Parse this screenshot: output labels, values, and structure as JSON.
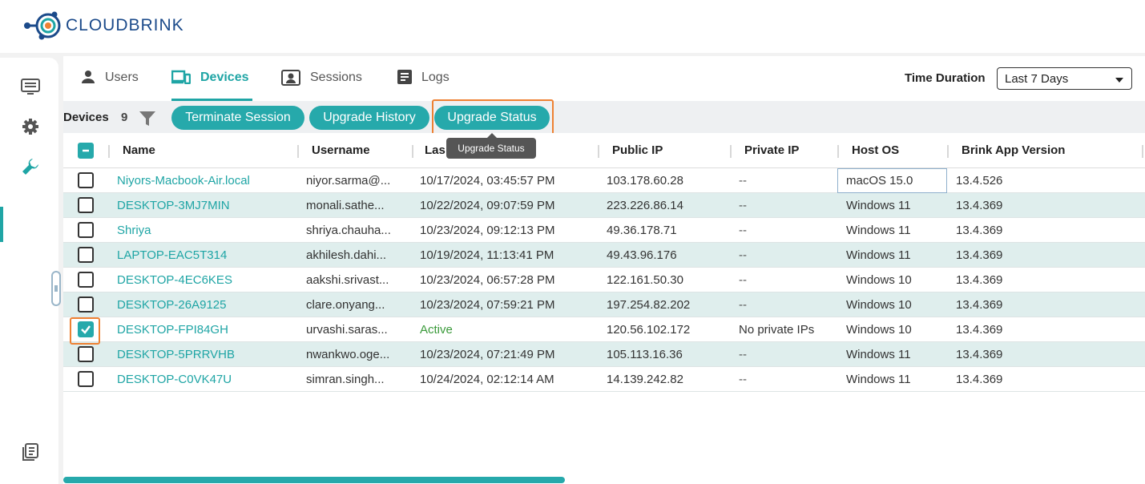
{
  "app": {
    "brand": "CLOUDBRINK"
  },
  "tabs": [
    {
      "label": "Users",
      "icon": "user-icon"
    },
    {
      "label": "Devices",
      "icon": "devices-icon"
    },
    {
      "label": "Sessions",
      "icon": "sessions-icon"
    },
    {
      "label": "Logs",
      "icon": "logs-icon"
    }
  ],
  "time_filter": {
    "label": "Time Duration",
    "value": "Last 7 Days"
  },
  "toolbar": {
    "devices_label": "Devices",
    "devices_count": "9",
    "terminate_label": "Terminate Session",
    "upgrade_history_label": "Upgrade History",
    "upgrade_status_label": "Upgrade Status"
  },
  "tooltip": {
    "text": "Upgrade Status"
  },
  "table": {
    "columns": [
      "Name",
      "Username",
      "Las",
      "Public IP",
      "Private IP",
      "Host OS",
      "Brink App Version"
    ],
    "rows": [
      {
        "name": "Niyors-Macbook-Air.local",
        "username": "niyor.sarma@...",
        "last": "10/17/2024, 03:45:57 PM",
        "public_ip": "103.178.60.28",
        "private_ip": "--",
        "host_os": "macOS 15.0",
        "version": "13.4.526",
        "checked": false
      },
      {
        "name": "DESKTOP-3MJ7MIN",
        "username": "monali.sathe...",
        "last": "10/22/2024, 09:07:59 PM",
        "public_ip": "223.226.86.14",
        "private_ip": "--",
        "host_os": "Windows 11",
        "version": "13.4.369",
        "checked": false
      },
      {
        "name": "Shriya",
        "username": "shriya.chauha...",
        "last": "10/23/2024, 09:12:13 PM",
        "public_ip": "49.36.178.71",
        "private_ip": "--",
        "host_os": "Windows 11",
        "version": "13.4.369",
        "checked": false
      },
      {
        "name": "LAPTOP-EAC5T314",
        "username": "akhilesh.dahi...",
        "last": "10/19/2024, 11:13:41 PM",
        "public_ip": "49.43.96.176",
        "private_ip": "--",
        "host_os": "Windows 11",
        "version": "13.4.369",
        "checked": false
      },
      {
        "name": "DESKTOP-4EC6KES",
        "username": "aakshi.srivast...",
        "last": "10/23/2024, 06:57:28 PM",
        "public_ip": "122.161.50.30",
        "private_ip": "--",
        "host_os": "Windows 10",
        "version": "13.4.369",
        "checked": false
      },
      {
        "name": "DESKTOP-26A9125",
        "username": "clare.onyang...",
        "last": "10/23/2024, 07:59:21 PM",
        "public_ip": "197.254.82.202",
        "private_ip": "--",
        "host_os": "Windows 10",
        "version": "13.4.369",
        "checked": false
      },
      {
        "name": "DESKTOP-FPI84GH",
        "username": "urvashi.saras...",
        "last": "Active",
        "public_ip": "120.56.102.172",
        "private_ip": "No private IPs",
        "host_os": "Windows 10",
        "version": "13.4.369",
        "checked": true
      },
      {
        "name": "DESKTOP-5PRRVHB",
        "username": "nwankwo.oge...",
        "last": "10/23/2024, 07:21:49 PM",
        "public_ip": "105.113.16.36",
        "private_ip": "--",
        "host_os": "Windows 11",
        "version": "13.4.369",
        "checked": false
      },
      {
        "name": "DESKTOP-C0VK47U",
        "username": "simran.singh...",
        "last": "10/24/2024, 02:12:14 AM",
        "public_ip": "14.139.242.82",
        "private_ip": "--",
        "host_os": "Windows 11",
        "version": "13.4.369",
        "checked": false
      }
    ]
  },
  "colors": {
    "accent": "#26a9ab",
    "highlight": "#ee8133",
    "row_alt": "#dfeeed",
    "brand": "#1b4a8a"
  }
}
